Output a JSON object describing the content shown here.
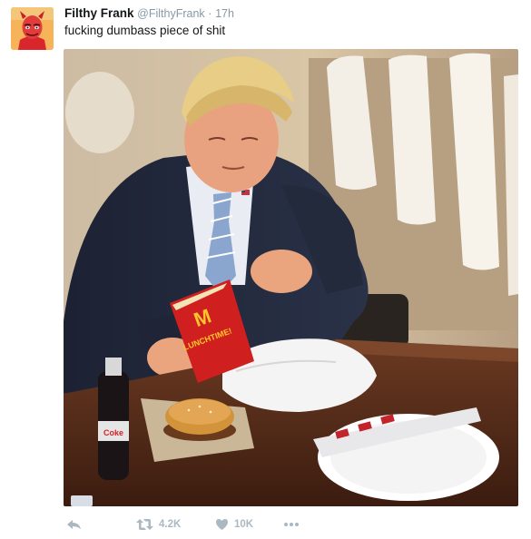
{
  "tweet": {
    "author_name": "Filthy Frank",
    "handle": "@FilthyFrank",
    "separator": "·",
    "time": "17h",
    "text": "fucking dumbass piece of shit"
  },
  "avatar": {
    "icon": "devil-avatar-icon",
    "background_color": "#f3a34a",
    "face_color": "#e23b3b"
  },
  "media": {
    "fry_box_text": "LUNCHTIME!",
    "fry_box_logo": "M",
    "bottle_label": "Coke"
  },
  "actions": {
    "reply_icon": "reply-icon",
    "retweet_icon": "retweet-icon",
    "retweet_count": "4.2K",
    "like_icon": "heart-icon",
    "like_count": "10K",
    "more_icon": "more-dots-icon"
  },
  "colors": {
    "name": "#14171a",
    "meta": "#8899a6",
    "action": "#aab8c2"
  }
}
